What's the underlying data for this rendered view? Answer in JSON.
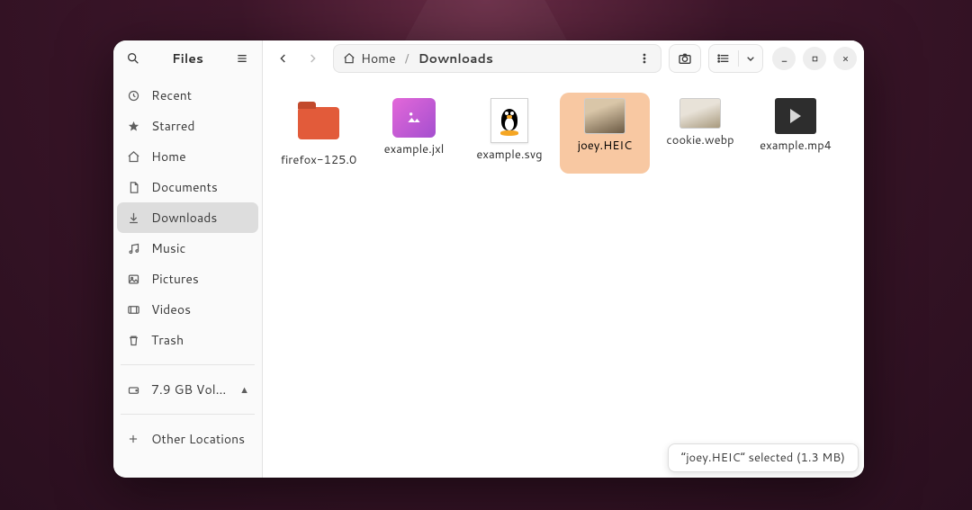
{
  "app_title": "Files",
  "breadcrumb": {
    "root_label": "Home",
    "current_label": "Downloads"
  },
  "sidebar": {
    "items": [
      {
        "icon": "recent-icon",
        "label": "Recent"
      },
      {
        "icon": "star-icon",
        "label": "Starred"
      },
      {
        "icon": "home-icon",
        "label": "Home"
      },
      {
        "icon": "document-icon",
        "label": "Documents"
      },
      {
        "icon": "downloads-icon",
        "label": "Downloads",
        "active": true
      },
      {
        "icon": "music-icon",
        "label": "Music"
      },
      {
        "icon": "pictures-icon",
        "label": "Pictures"
      },
      {
        "icon": "videos-icon",
        "label": "Videos"
      },
      {
        "icon": "trash-icon",
        "label": "Trash"
      }
    ],
    "volumes": [
      {
        "icon": "drive-icon",
        "label": "7.9 GB Vol…",
        "ejectable": true
      }
    ],
    "other_label": "Other Locations"
  },
  "files": [
    {
      "name": "firefox-125.0",
      "kind": "folder"
    },
    {
      "name": "example.jxl",
      "kind": "jxl"
    },
    {
      "name": "example.svg",
      "kind": "svgimg"
    },
    {
      "name": "joey.HEIC",
      "kind": "photo",
      "selected": true
    },
    {
      "name": "cookie.webp",
      "kind": "photo2"
    },
    {
      "name": "example.mp4",
      "kind": "video"
    }
  ],
  "status_text": "“joey.HEIC” selected  (1.3 MB)"
}
